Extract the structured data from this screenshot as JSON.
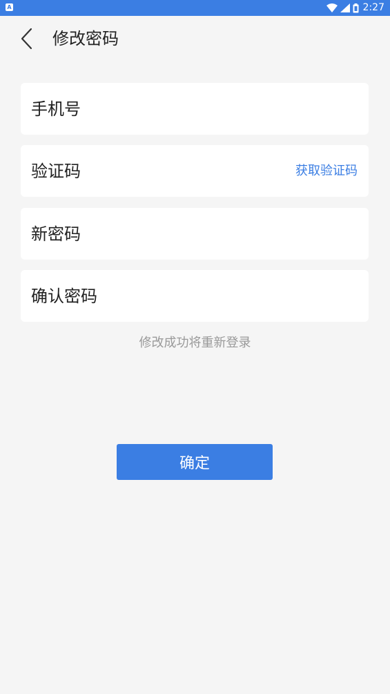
{
  "status_bar": {
    "left_icon": "A",
    "time": "2:27",
    "icons": [
      "wifi-icon",
      "signal-icon",
      "battery-icon"
    ]
  },
  "header": {
    "back_icon": "chevron-left-icon",
    "title": "修改密码"
  },
  "form": {
    "phone_placeholder": "手机号",
    "code_placeholder": "验证码",
    "get_code_label": "获取验证码",
    "new_password_placeholder": "新密码",
    "confirm_password_placeholder": "确认密码"
  },
  "hint": "修改成功将重新登录",
  "confirm_label": "确定",
  "colors": {
    "accent": "#3b7ee3",
    "background": "#f5f5f5",
    "field_background": "#ffffff",
    "hint_text": "#999999"
  }
}
